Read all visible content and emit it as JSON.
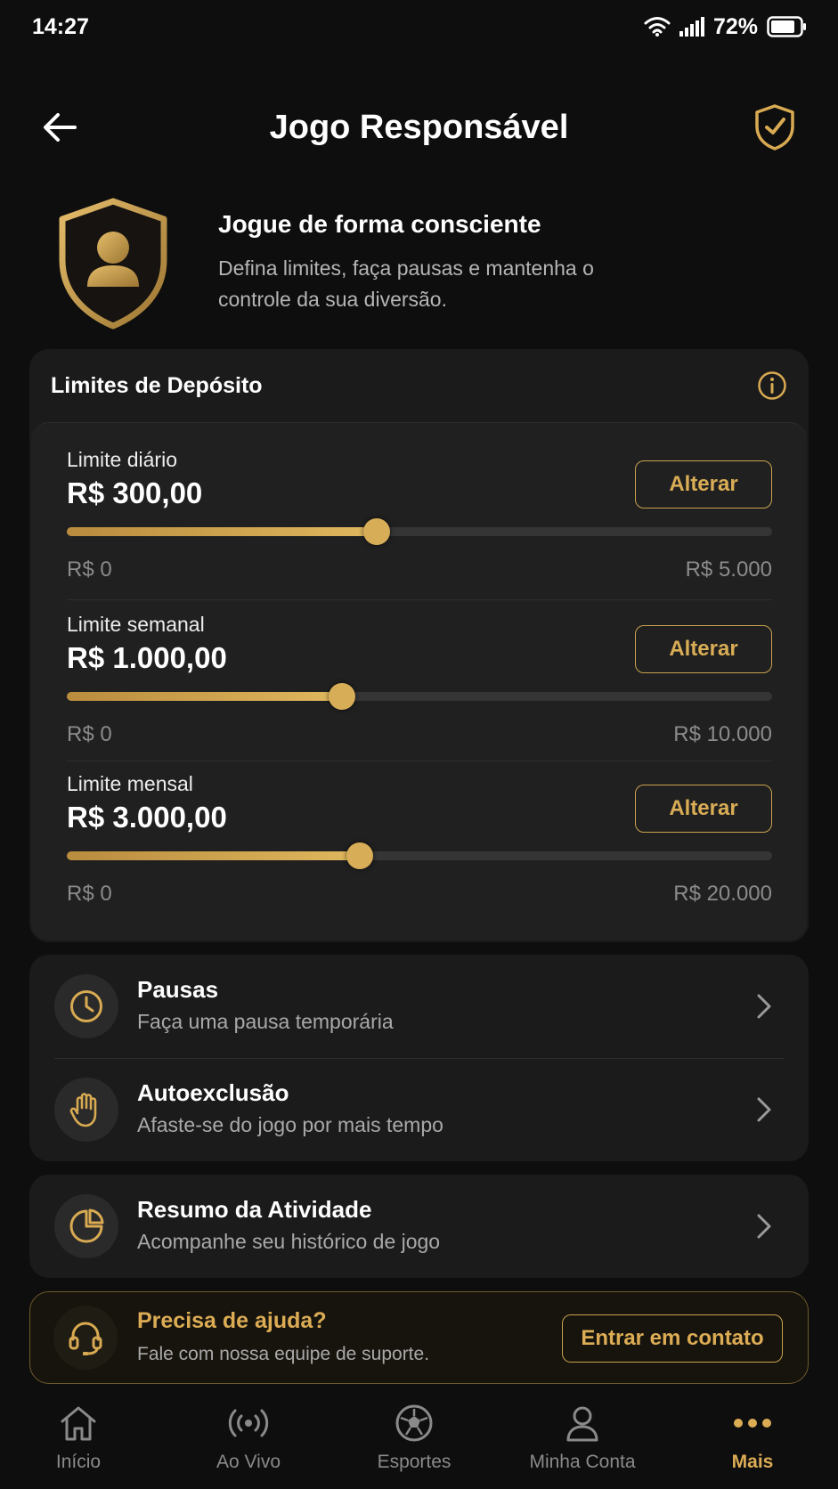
{
  "status_bar": {
    "time": "14:27",
    "battery": "72%"
  },
  "header": {
    "title": "Jogo Responsável"
  },
  "intro": {
    "title": "Jogue de forma consciente",
    "description": "Defina limites, faça pausas e mantenha o controle da sua diversão."
  },
  "deposit": {
    "title": "Limites de Depósito",
    "limits": [
      {
        "label": "Limite diário",
        "value": "R$ 300,00",
        "button": "Alterar",
        "min": "R$ 0",
        "max": "R$ 5.000",
        "fill": 0.44
      },
      {
        "label": "Limite semanal",
        "value": "R$ 1.000,00",
        "button": "Alterar",
        "min": "R$ 0",
        "max": "R$ 10.000",
        "fill": 0.39
      },
      {
        "label": "Limite mensal",
        "value": "R$ 3.000,00",
        "button": "Alterar",
        "min": "R$ 0",
        "max": "R$ 20.000",
        "fill": 0.415
      }
    ]
  },
  "menu": {
    "pausas": {
      "title": "Pausas",
      "subtitle": "Faça uma pausa temporária",
      "icon": "clock-icon"
    },
    "autoexclusao": {
      "title": "Autoexclusão",
      "subtitle": "Afaste-se do jogo por mais tempo",
      "icon": "hand-icon"
    },
    "atividade": {
      "title": "Resumo da Atividade",
      "subtitle": "Acompanhe seu histórico de jogo",
      "icon": "pie-chart-icon"
    }
  },
  "help": {
    "title": "Precisa de ajuda?",
    "subtitle": "Fale com nossa equipe de suporte.",
    "button": "Entrar em contato"
  },
  "bottom_nav": [
    {
      "label": "Início",
      "icon": "home-icon",
      "active": false
    },
    {
      "label": "Ao Vivo",
      "icon": "live-icon",
      "active": false
    },
    {
      "label": "Esportes",
      "icon": "soccer-ball-icon",
      "active": false
    },
    {
      "label": "Minha Conta",
      "icon": "user-icon",
      "active": false
    },
    {
      "label": "Mais",
      "icon": "more-icon",
      "active": true
    }
  ],
  "colors": {
    "accent": "#dcac55",
    "background": "#0e0e0e",
    "card": "#1b1b1b"
  }
}
